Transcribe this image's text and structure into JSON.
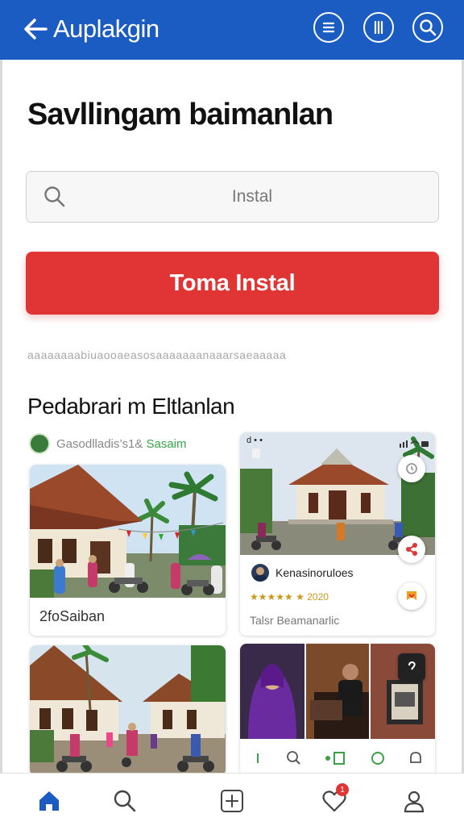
{
  "appbar": {
    "title": "Auplakgin",
    "icons": [
      "back-arrow-icon",
      "list-icon",
      "info-icon",
      "search-icon"
    ]
  },
  "page": {
    "title": "Savllingam baimanlan"
  },
  "search": {
    "placeholder": "Instal"
  },
  "install_button": {
    "label": "Toma Instal"
  },
  "tagline": "aaaaaaaabiuaooaeasosaaaaaaanaaarsaeaaaaa",
  "section": {
    "title": "Pedabrari m Eltlanlan",
    "channel_prefix": "Gasodlladis’s1&",
    "channel_accent": "Sasaim"
  },
  "cards": {
    "c1": {
      "caption": "2foSaiban"
    },
    "c2": {
      "status_time": "d • •",
      "author": "Kenasinoruloes",
      "rating_text": "★★★★★ ★ 2020",
      "caption": "Talsr Beamanarlic"
    },
    "c3": {},
    "c4": {
      "action_icons": [
        "info-icon",
        "search-icon",
        "bookmark-icon",
        "chat-icon",
        "notification-icon"
      ]
    }
  },
  "bottom_nav": {
    "items": [
      "home-icon",
      "search-icon",
      "add-icon",
      "favorites-icon",
      "profile-icon"
    ],
    "badge_count": "1"
  },
  "colors": {
    "appbar": "#1a5cc2",
    "install": "#e13535",
    "home_active": "#1a5cc2",
    "accent_green": "#37a84a"
  }
}
